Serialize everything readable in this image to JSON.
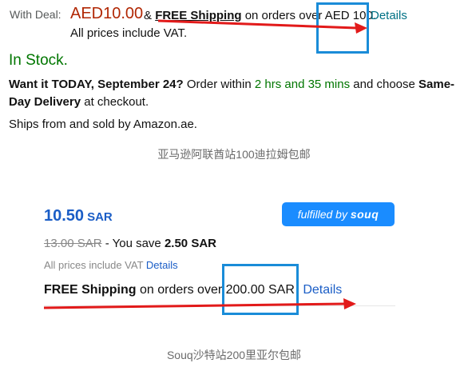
{
  "amazon": {
    "with_deal_label": "With Deal:",
    "deal_price": "AED10.00",
    "amp": "&",
    "free_shipping": "FREE Shipping",
    "shipping_rest": "on orders over AED 100.",
    "details_link": "Details",
    "vat_note": "All prices include VAT.",
    "stock_status": "In Stock.",
    "want_bold": "Want it TODAY, September 24?",
    "order_within": "Order within",
    "countdown": "2 hrs and 35 mins",
    "choose": "and choose",
    "same_day_a": "Same-",
    "same_day_b": "Day Delivery",
    "at_checkout": "at checkout.",
    "ships_from": "Ships from and sold by Amazon.ae."
  },
  "caption_1": "亚马逊阿联酋站100迪拉姆包邮",
  "souq": {
    "price": "10.50",
    "currency": "SAR",
    "badge_prefix": "fulfilled by",
    "badge_brand": "souq",
    "was_price": "13.00 SAR",
    "save_text": "- You save",
    "save_amount": "2.50 SAR",
    "vat_note": "All prices include VAT",
    "vat_details": "Details",
    "free_shipping": "FREE Shipping",
    "shipping_rest": "on orders over 200.00 SAR",
    "details": "Details"
  },
  "caption_2": "Souq沙特站200里亚尔包邮",
  "colors": {
    "highlight_box": "#1a8cd8",
    "arrow": "#e21a1a",
    "souq_blue": "#1a5dc6",
    "deal_red": "#b12704",
    "stock_green": "#007600"
  }
}
